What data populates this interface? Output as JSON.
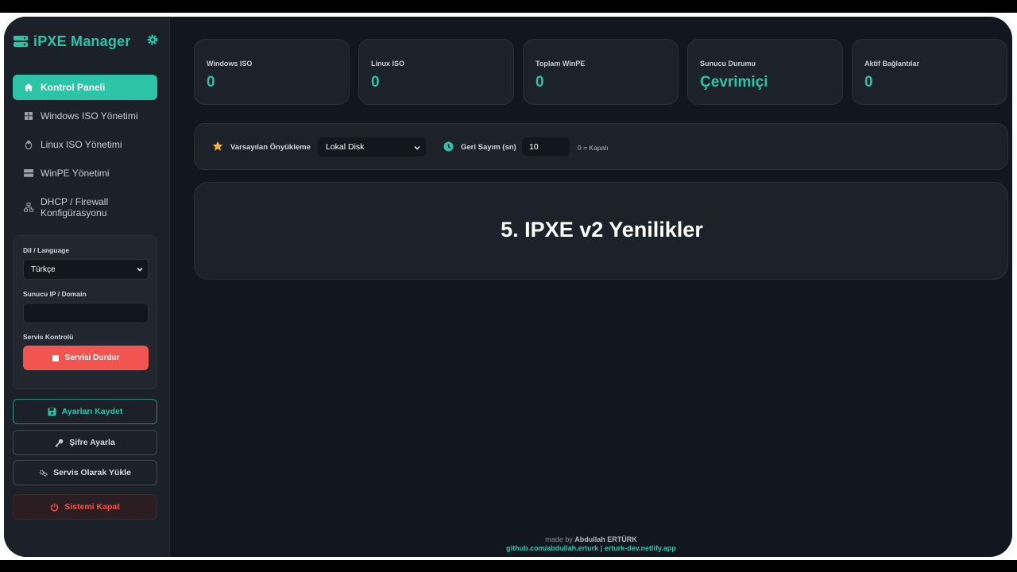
{
  "app": {
    "title": "iPXE Manager",
    "accent_color": "#2cc4a8",
    "danger_color": "#f2544f"
  },
  "sidebar": {
    "items": [
      {
        "label": "Kontrol Paneli",
        "icon": "home-icon",
        "active": true
      },
      {
        "label": "Windows ISO Yönetimi",
        "icon": "windows-icon",
        "active": false
      },
      {
        "label": "Linux ISO Yönetimi",
        "icon": "linux-icon",
        "active": false
      },
      {
        "label": "WinPE Yönetimi",
        "icon": "server-icon",
        "active": false
      },
      {
        "label": "DHCP / Firewall Konfigürasyonu",
        "icon": "network-icon",
        "active": false
      }
    ],
    "panel": {
      "language_label": "Dil / Language",
      "language_value": "Türkçe",
      "server_label": "Sunucu IP / Domain",
      "server_value": "",
      "service_label": "Servis Kontrolü",
      "stop_button": "Servisi Durdur"
    },
    "buttons": {
      "save": "Ayarları Kaydet",
      "password": "Şifre Ayarla",
      "install_service": "Servis Olarak Yükle",
      "shutdown": "Sistemi Kapat"
    }
  },
  "stats": [
    {
      "label": "Windows ISO",
      "value": "0"
    },
    {
      "label": "Linux ISO",
      "value": "0"
    },
    {
      "label": "Toplam WinPE",
      "value": "0"
    },
    {
      "label": "Sunucu Durumu",
      "value": "Çevrimiçi"
    },
    {
      "label": "Aktif Bağlantılar",
      "value": "0"
    }
  ],
  "settings_bar": {
    "default_boot_label": "Varsayılan Önyükleme",
    "default_boot_value": "Lokal Disk",
    "countdown_label": "Geri Sayım (sn)",
    "countdown_value": "10",
    "countdown_hint": "0 = Kapalı"
  },
  "content": {
    "heading": "5. IPXE v2 Yenilikler"
  },
  "footer": {
    "made_by_prefix": "made by",
    "author": "Abdullah ERTÜRK",
    "github": "github.com/abdullah.erturk",
    "separator": "|",
    "website": "erturk-dev.netlify.app"
  }
}
